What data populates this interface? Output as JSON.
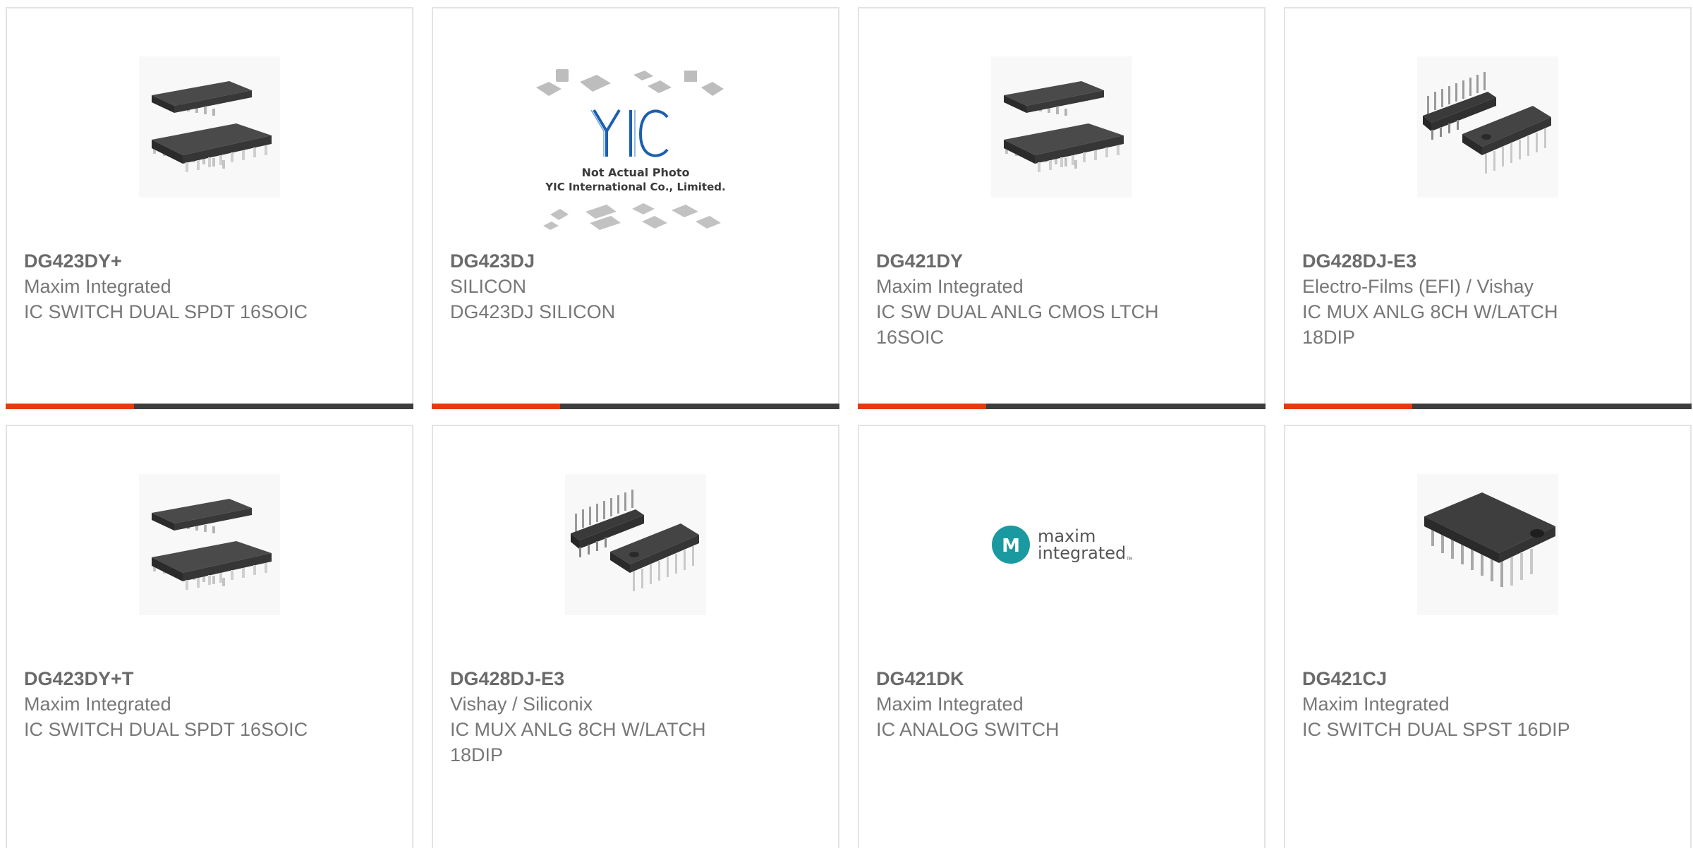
{
  "colors": {
    "accent": "#e8380d",
    "bar_dark": "#3d3d3d",
    "card_border": "#e3e3e3",
    "text": "#666666"
  },
  "products": [
    {
      "part": "DG423DY+",
      "manufacturer": "Maxim Integrated",
      "description": "IC SWITCH DUAL SPDT 16SOIC",
      "image": "soic-16-chips-image"
    },
    {
      "part": "DG423DJ",
      "manufacturer": "SILICON",
      "description": "DG423DJ SILICON",
      "image": "yic-placeholder-image",
      "placeholder": {
        "logo": "YIC",
        "line1": "Not Actual Photo",
        "line2": "YIC International Co., Limited."
      }
    },
    {
      "part": "DG421DY",
      "manufacturer": "Maxim Integrated",
      "description": "IC SW DUAL ANLG CMOS LTCH 16SOIC",
      "image": "soic-16-chips-image"
    },
    {
      "part": "DG428DJ-E3",
      "manufacturer": "Electro-Films (EFI) / Vishay",
      "description": "IC MUX ANLG 8CH W/LATCH 18DIP",
      "image": "dip-chips-image"
    },
    {
      "part": "DG423DY+T",
      "manufacturer": "Maxim Integrated",
      "description": "IC SWITCH DUAL SPDT 16SOIC",
      "image": "soic-16-chips-image"
    },
    {
      "part": "DG428DJ-E3",
      "manufacturer": "Vishay / Siliconix",
      "description": "IC MUX ANLG 8CH W/LATCH 18DIP",
      "image": "dip-chips-image"
    },
    {
      "part": "DG421DK",
      "manufacturer": "Maxim Integrated",
      "description": "IC ANALOG SWITCH",
      "image": "maxim-logo-image",
      "logo": {
        "word1": "maxim",
        "word2": "integrated",
        "tm": "TM"
      }
    },
    {
      "part": "DG421CJ",
      "manufacturer": "Maxim Integrated",
      "description": "IC SWITCH DUAL SPST 16DIP",
      "image": "dip-single-chip-image"
    }
  ]
}
